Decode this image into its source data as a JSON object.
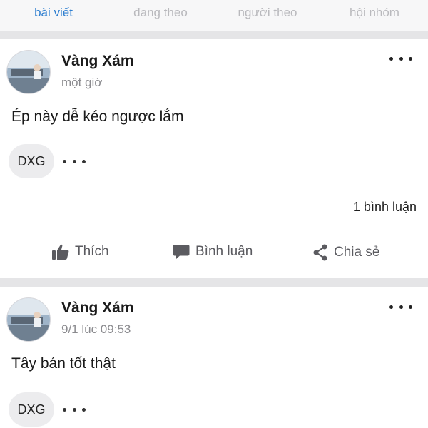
{
  "tabs": [
    {
      "label": "bài viết",
      "active": true
    },
    {
      "label": "đang theo",
      "active": false
    },
    {
      "label": "người theo",
      "active": false
    },
    {
      "label": "hội nhóm",
      "active": false
    }
  ],
  "colors": {
    "accent": "#2f7fd0",
    "inactive_tab": "#b9b9bd",
    "background": "#e9e9eb"
  },
  "posts": [
    {
      "author": "Vàng Xám",
      "time": "một giờ",
      "text": "Ép này dễ kéo ngược lắm",
      "tag": "DXG",
      "comment_count": "1 bình luận",
      "actions": {
        "like": "Thích",
        "comment": "Bình luận",
        "share": "Chia sẻ"
      }
    },
    {
      "author": "Vàng Xám",
      "time": "9/1 lúc 09:53",
      "text": "Tây bán tốt thật",
      "tag": "DXG"
    }
  ],
  "icons": {
    "more": "more-horizontal-icon",
    "like": "thumbs-up-icon",
    "comment": "speech-bubble-icon",
    "share": "share-icon"
  }
}
